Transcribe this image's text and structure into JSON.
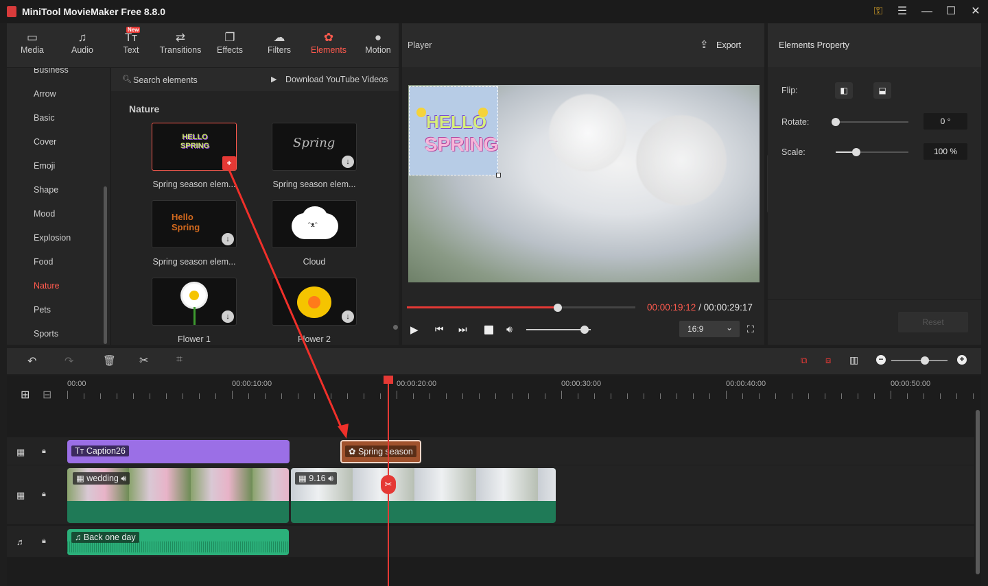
{
  "app": {
    "title": "MiniTool MovieMaker Free 8.8.0"
  },
  "window_controls": [
    "key-icon",
    "menu-icon",
    "minimize-icon",
    "maximize-icon",
    "close-icon"
  ],
  "toolbar": {
    "items": [
      {
        "label": "Media",
        "icon": "media-icon"
      },
      {
        "label": "Audio",
        "icon": "audio-icon"
      },
      {
        "label": "Text",
        "icon": "text-icon",
        "badge": "New"
      },
      {
        "label": "Transitions",
        "icon": "transitions-icon"
      },
      {
        "label": "Effects",
        "icon": "effects-icon"
      },
      {
        "label": "Filters",
        "icon": "filters-icon"
      },
      {
        "label": "Elements",
        "icon": "elements-icon",
        "active": true
      },
      {
        "label": "Motion",
        "icon": "motion-icon"
      }
    ]
  },
  "categories": {
    "items": [
      "Business",
      "Arrow",
      "Basic",
      "Cover",
      "Emoji",
      "Shape",
      "Mood",
      "Explosion",
      "Food",
      "Nature",
      "Pets",
      "Sports"
    ],
    "active": "Nature"
  },
  "library": {
    "search_placeholder": "Search elements",
    "download_label": "Download YouTube Videos",
    "section": "Nature",
    "items": [
      {
        "label": "Spring season elem...",
        "selected": true,
        "thumb_text": "HELLO SPRING"
      },
      {
        "label": "Spring season elem...",
        "thumb_text": "Spring"
      },
      {
        "label": "Spring season elem...",
        "thumb_text": "Hello Spring"
      },
      {
        "label": "Cloud"
      },
      {
        "label": "Flower 1"
      },
      {
        "label": "Flower 2"
      }
    ]
  },
  "player": {
    "title": "Player",
    "export_label": "Export",
    "current_time": "00:00:19:12",
    "total_time": "00:00:29:17",
    "time_separator": "/",
    "progress": 0.66,
    "volume": 0.9,
    "aspect_ratio": "16:9",
    "overlay": {
      "line1": "HELLO",
      "line2": "SPRING"
    }
  },
  "properties": {
    "title": "Elements Property",
    "flip_label": "Flip:",
    "rotate_label": "Rotate:",
    "rotate_value": "0 °",
    "scale_label": "Scale:",
    "scale_value": "100 %",
    "rotate_level": 0.0,
    "scale_level": 0.28,
    "reset_label": "Reset"
  },
  "timeline": {
    "ticks": [
      "00:00",
      "00:00:10:00",
      "00:00:20:00",
      "00:00:30:00",
      "00:00:40:00",
      "00:00:50:00"
    ],
    "zoom_level": 0.6,
    "clips": {
      "caption": "Caption26",
      "element": "Spring season",
      "video1": "wedding",
      "video2": "9.16",
      "audio": "Back one day"
    }
  },
  "colors": {
    "accent": "#ff5a4e",
    "caption_clip": "#9b6fe6",
    "video_clip": "#1f7a57",
    "audio_clip": "#2bb07a",
    "element_clip": "#a0522d"
  }
}
